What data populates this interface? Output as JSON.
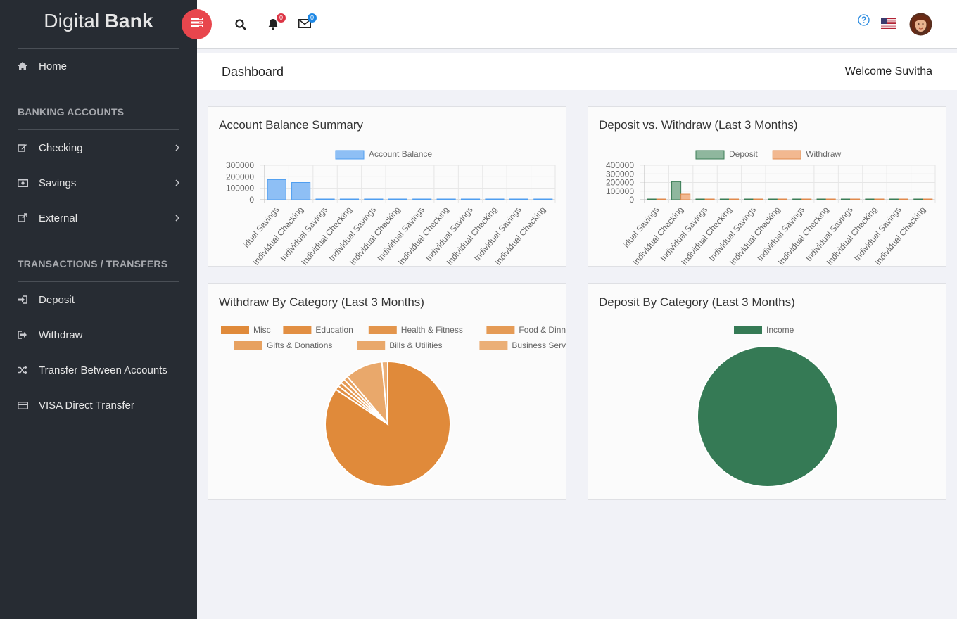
{
  "app": {
    "brand_part1": "Digital",
    "brand_part2": "Bank"
  },
  "sidebar": {
    "home": {
      "label": "Home",
      "icon": "home-icon"
    },
    "section_accounts": "BANKING ACCOUNTS",
    "accounts": [
      {
        "label": "Checking",
        "icon": "edit-icon"
      },
      {
        "label": "Savings",
        "icon": "money-icon"
      },
      {
        "label": "External",
        "icon": "external-link-icon"
      }
    ],
    "section_transactions": "TRANSACTIONS / TRANSFERS",
    "transactions": [
      {
        "label": "Deposit",
        "icon": "sign-in-icon"
      },
      {
        "label": "Withdraw",
        "icon": "sign-out-icon"
      },
      {
        "label": "Transfer Between Accounts",
        "icon": "random-icon"
      },
      {
        "label": "VISA Direct Transfer",
        "icon": "credit-card-icon"
      }
    ]
  },
  "topbar": {
    "notifications_count": "0",
    "messages_count": "0"
  },
  "header": {
    "title": "Dashboard",
    "welcome": "Welcome Suvitha"
  },
  "cards": {
    "balance_title": "Account Balance Summary",
    "dw_title": "Deposit vs. Withdraw (Last 3 Months)",
    "withdraw_cat_title": "Withdraw By Category (Last 3 Months)",
    "deposit_cat_title": "Deposit By Category (Last 3 Months)"
  },
  "colors": {
    "balance": "#8ebff5",
    "balance_stroke": "#4f9ef0",
    "deposit": "#8fb79e",
    "deposit_stroke": "#3b7d56",
    "withdraw": "#f2b890",
    "withdraw_stroke": "#e08a4c",
    "income": "#357a55"
  },
  "chart_data": [
    {
      "type": "bar",
      "categories": [
        "Individual Savings",
        "Individual Checking",
        "Individual Savings",
        "Individual Checking",
        "Individual Savings",
        "Individual Checking",
        "Individual Savings",
        "Individual Checking",
        "Individual Savings",
        "Individual Checking",
        "Individual Savings",
        "Individual Checking"
      ],
      "series": [
        {
          "name": "Account Balance",
          "values": [
            175000,
            150000,
            1500,
            1500,
            1500,
            1500,
            1500,
            1500,
            1500,
            1500,
            1500,
            1500
          ]
        }
      ],
      "yticks": [
        "300000",
        "200000",
        "100000",
        "0"
      ],
      "ylim": [
        0,
        300000
      ],
      "grid": true,
      "legend": "top"
    },
    {
      "type": "bar",
      "categories": [
        "Individual Savings",
        "Individual Checking",
        "Individual Savings",
        "Individual Checking",
        "Individual Savings",
        "Individual Checking",
        "Individual Savings",
        "Individual Checking",
        "Individual Savings",
        "Individual Checking",
        "Individual Savings",
        "Individual Checking"
      ],
      "series": [
        {
          "name": "Deposit",
          "values": [
            2000,
            210000,
            1000,
            1000,
            1000,
            2000,
            2000,
            3000,
            3000,
            4000,
            2000,
            5000
          ]
        },
        {
          "name": "Withdraw",
          "values": [
            1000,
            65000,
            1000,
            3000,
            1000,
            2000,
            2000,
            2000,
            2000,
            2000,
            2000,
            3000
          ]
        }
      ],
      "yticks": [
        "400000",
        "300000",
        "200000",
        "100000",
        "0"
      ],
      "ylim": [
        0,
        400000
      ],
      "grid": true,
      "legend": "top"
    },
    {
      "type": "pie",
      "labels": [
        "Misc",
        "Education",
        "Health & Fitness",
        "Food & Dinning",
        "Gifts & Donations",
        "Bills & Utilities",
        "Business Services"
      ],
      "values": [
        84.4,
        1.1,
        1.1,
        1.1,
        1.1,
        9.7,
        1.5
      ],
      "colors": [
        "#e08a3a",
        "#e28f43",
        "#e3954c",
        "#e59b56",
        "#e7a160",
        "#e9a86b",
        "#ebaf77"
      ],
      "legend": "top"
    },
    {
      "type": "pie",
      "labels": [
        "Income"
      ],
      "values": [
        100
      ],
      "colors": [
        "#357a55"
      ],
      "legend": "top"
    }
  ]
}
